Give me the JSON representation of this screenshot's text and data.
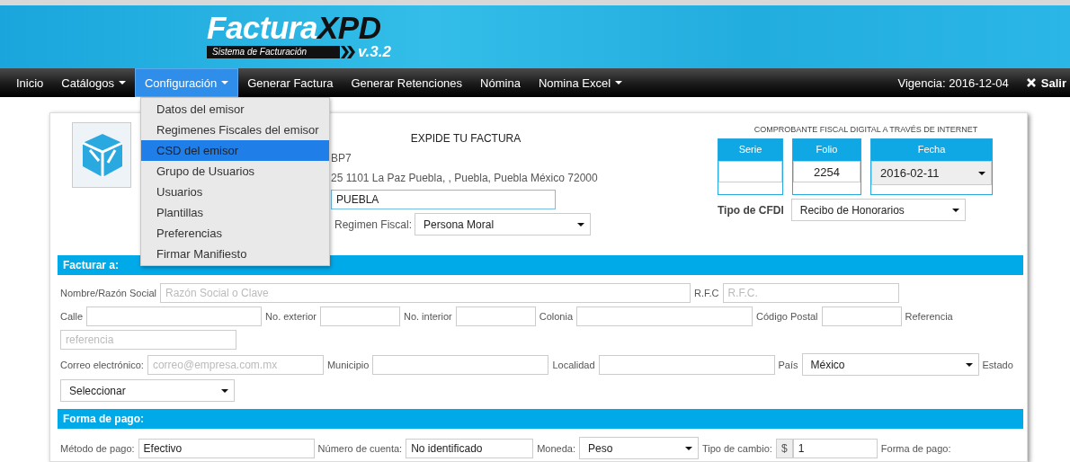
{
  "banner": {
    "brand_light": "Factura",
    "brand_dark": "XPD",
    "tagline": "Sistema de Facturación",
    "version": "v.3.2"
  },
  "nav": {
    "items": [
      {
        "label": "Inicio",
        "dropdown": false,
        "selected": false
      },
      {
        "label": "Catálogos",
        "dropdown": true,
        "selected": false
      },
      {
        "label": "Configuración",
        "dropdown": true,
        "selected": true
      },
      {
        "label": "Generar Factura",
        "dropdown": false,
        "selected": false
      },
      {
        "label": "Generar Retenciones",
        "dropdown": false,
        "selected": false
      },
      {
        "label": "Nómina",
        "dropdown": false,
        "selected": false
      },
      {
        "label": "Nomina Excel",
        "dropdown": true,
        "selected": false
      }
    ],
    "vigencia": "Vigencia: 2016-12-04",
    "logout": "Salir"
  },
  "dropdown_menu": {
    "items": [
      {
        "label": "Datos del emisor",
        "selected": false
      },
      {
        "label": "Regimenes Fiscales del emisor",
        "selected": false
      },
      {
        "label": "CSD del emisor",
        "selected": true
      },
      {
        "label": "Grupo de Usuarios",
        "selected": false
      },
      {
        "label": "Usuarios",
        "selected": false
      },
      {
        "label": "Plantillas",
        "selected": false
      },
      {
        "label": "Preferencias",
        "selected": false
      },
      {
        "label": "Firmar Manifiesto",
        "selected": false
      }
    ]
  },
  "emisor": {
    "heading": "EXPIDE TU FACTURA",
    "lines": [
      "BP7",
      "25 1101 La Paz Puebla, , Puebla, Puebla México 72000"
    ],
    "city_field": {
      "value": "PUEBLA"
    },
    "regimen": {
      "label": "Regimen Fiscal:",
      "value": "Persona Moral"
    }
  },
  "comprobante": {
    "title": "COMPROBANTE FISCAL DIGITAL A TRAVÉS DE INTERNET",
    "boxes": [
      {
        "label": "Serie",
        "kind": "input"
      },
      {
        "label": "Folio",
        "kind": "input",
        "value": "2254"
      },
      {
        "label": "Fecha",
        "kind": "select",
        "value": "2016-02-11"
      }
    ]
  },
  "tipo_cfdi": {
    "label": "Tipo de CFDI",
    "value": "Recibo de Honorarios"
  },
  "sections": [
    {
      "title": "Facturar a:",
      "fields": [
        {
          "label": "Nombre/Razón Social",
          "kind": "input",
          "placeholder": "Razón Social o Clave"
        },
        {
          "label": "R.F.C",
          "kind": "input",
          "placeholder": "R.F.C."
        },
        {
          "label": "Calle",
          "kind": "input"
        },
        {
          "label": "No. exterior",
          "kind": "input"
        },
        {
          "label": "No. interior",
          "kind": "input"
        },
        {
          "label": "Colonia",
          "kind": "input"
        },
        {
          "label": "Código Postal",
          "kind": "input"
        },
        {
          "label": "Referencia",
          "kind": "input",
          "placeholder": "referencia"
        },
        {
          "label": "Correo electrónico:",
          "kind": "input",
          "placeholder": "correo@empresa.com.mx"
        },
        {
          "label": "Municipio",
          "kind": "input"
        },
        {
          "label": "Localidad",
          "kind": "input"
        },
        {
          "label": "País",
          "kind": "select",
          "value": "México"
        },
        {
          "label": "Estado",
          "kind": "none"
        },
        {
          "kind": "select",
          "value": "Seleccionar"
        }
      ]
    },
    {
      "title": "Forma de pago:",
      "fields": [
        {
          "label": "Método de pago:",
          "kind": "input",
          "value": "Efectivo"
        },
        {
          "label": "Número de cuenta:",
          "kind": "input",
          "value": "No identificado"
        },
        {
          "label": "Moneda:",
          "kind": "select",
          "value": "Peso"
        },
        {
          "label": "Tipo de cambio:",
          "kind": "currency",
          "prefix": "$",
          "value": "1"
        },
        {
          "label": "Forma de pago:",
          "kind": "none"
        }
      ]
    }
  ]
}
